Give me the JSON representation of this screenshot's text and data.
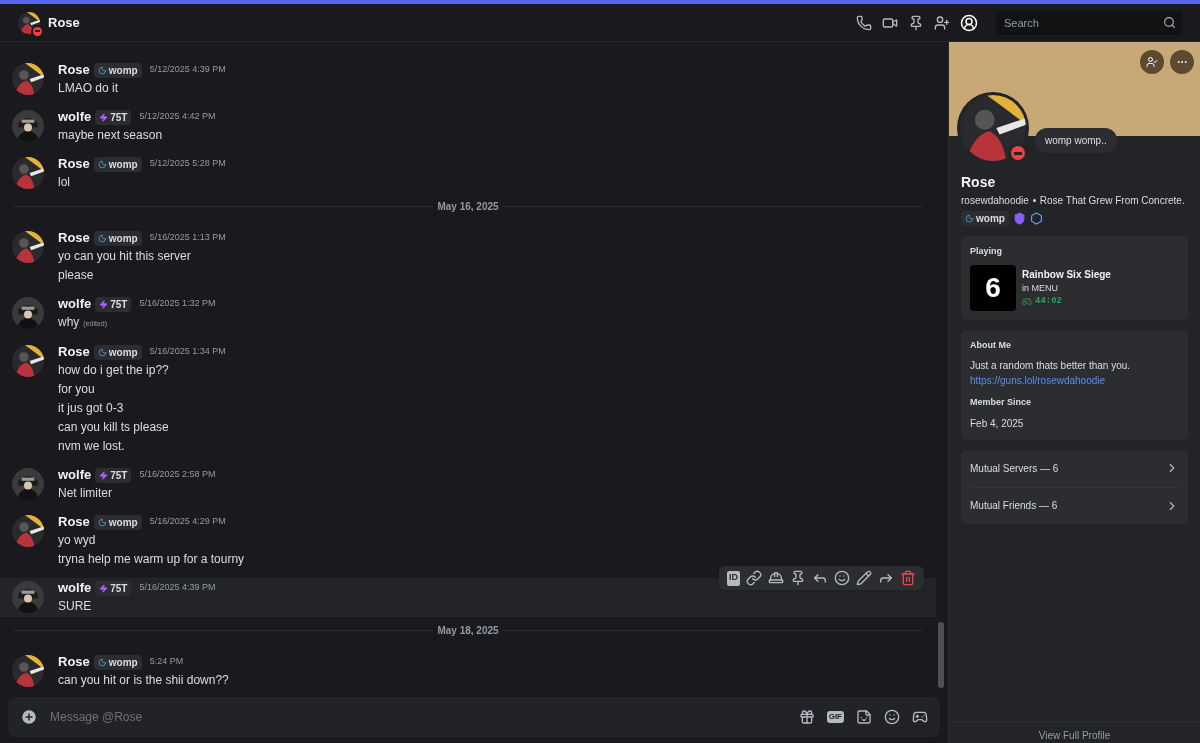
{
  "header": {
    "title": "Rose",
    "search": {
      "placeholder": "Search"
    }
  },
  "messages": [
    {
      "kind": "message",
      "author": {
        "name": "Rose",
        "kind": "friend"
      },
      "badge": "womp",
      "time": "5/12/2025 4:39 PM",
      "lines": [
        "LMAO do it"
      ],
      "highlighted": false
    },
    {
      "kind": "message",
      "author": {
        "name": "wolfe",
        "kind": "self"
      },
      "badge": "75T",
      "time": "5/12/2025 4:42 PM",
      "lines": [
        "maybe next season"
      ],
      "highlighted": false
    },
    {
      "kind": "message",
      "author": {
        "name": "Rose",
        "kind": "friend"
      },
      "badge": "womp",
      "time": "5/12/2025 5:28 PM",
      "lines": [
        "lol"
      ],
      "highlighted": false
    },
    {
      "kind": "divider",
      "label": "May 16, 2025"
    },
    {
      "kind": "message",
      "author": {
        "name": "Rose",
        "kind": "friend"
      },
      "badge": "womp",
      "time": "5/16/2025 1:13 PM",
      "lines": [
        "yo can you hit this server",
        "please"
      ],
      "highlighted": false
    },
    {
      "kind": "message",
      "author": {
        "name": "wolfe",
        "kind": "self"
      },
      "badge": "75T",
      "time": "5/16/2025 1:32 PM",
      "lines": [
        "why"
      ],
      "edited": "(edited)",
      "highlighted": false
    },
    {
      "kind": "message",
      "author": {
        "name": "Rose",
        "kind": "friend"
      },
      "badge": "womp",
      "time": "5/16/2025 1:34 PM",
      "lines": [
        "how do i get the ip??",
        "for you",
        "it jus got 0-3",
        "can you kill ts please",
        "nvm we lost."
      ],
      "highlighted": false
    },
    {
      "kind": "message",
      "author": {
        "name": "wolfe",
        "kind": "self"
      },
      "badge": "75T",
      "time": "5/16/2025 2:58 PM",
      "lines": [
        "Net limiter"
      ],
      "highlighted": false
    },
    {
      "kind": "message",
      "author": {
        "name": "Rose",
        "kind": "friend"
      },
      "badge": "womp",
      "time": "5/16/2025 4:29 PM",
      "lines": [
        "yo wyd",
        "tryna help me warm up for a tourny"
      ],
      "highlighted": false
    },
    {
      "kind": "message",
      "author": {
        "name": "wolfe",
        "kind": "self"
      },
      "badge": "75T",
      "time": "5/16/2025 4:39 PM",
      "lines": [
        "SURE"
      ],
      "highlighted": true
    },
    {
      "kind": "divider",
      "label": "May 18, 2025"
    },
    {
      "kind": "message",
      "author": {
        "name": "Rose",
        "kind": "friend"
      },
      "badge": "womp",
      "time": "5:24 PM",
      "lines": [
        "can you hit or is the shii down??"
      ],
      "highlighted": false
    }
  ],
  "message_toolbar": {
    "id_label": "ID"
  },
  "composer": {
    "placeholder": "Message @Rose",
    "gif_label": "GIF"
  },
  "profile": {
    "status_bubble": "womp womp..",
    "name": "Rose",
    "username": "rosewdahoodie",
    "tagline": "Rose That Grew From Concrete.",
    "tag": "womp",
    "activity": {
      "heading": "Playing",
      "game": "Rainbow Six Siege",
      "game_icon_label": "6",
      "state": "in MENU",
      "elapsed": "44:02"
    },
    "about": {
      "heading": "About Me",
      "text": "Just a random thats better than you.",
      "link": "https://guns.lol/rosewdahoodie"
    },
    "member_since": {
      "heading": "Member Since",
      "date": "Feb 4, 2025"
    },
    "mutuals": [
      "Mutual Servers — 6",
      "Mutual Friends — 6"
    ],
    "footer": "View Full Profile"
  }
}
